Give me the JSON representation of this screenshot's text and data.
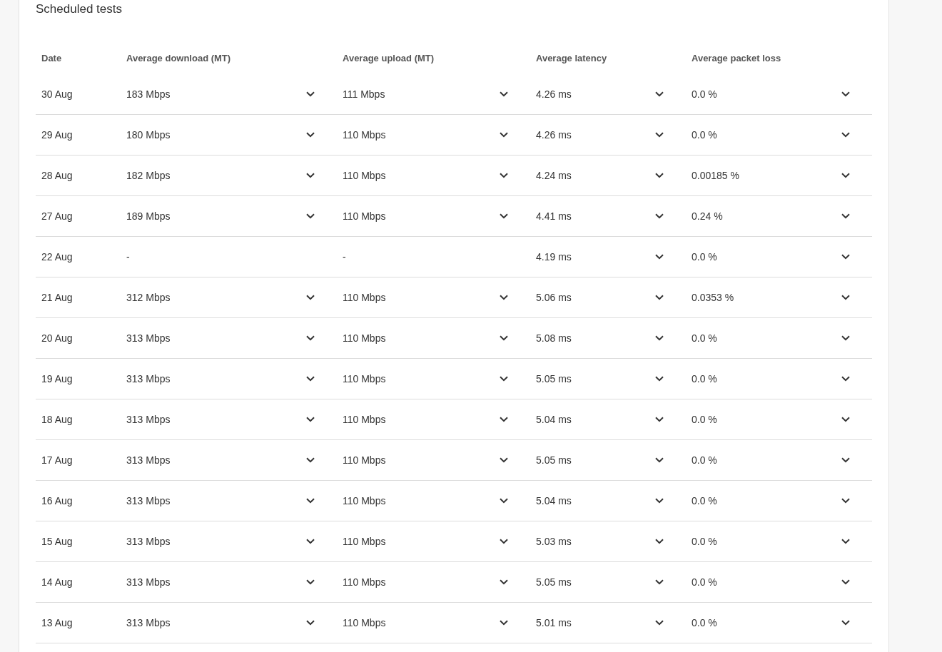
{
  "section": {
    "title": "Scheduled tests"
  },
  "table": {
    "columns": [
      "Date",
      "Average download (MT)",
      "Average upload (MT)",
      "Average latency",
      "Average packet loss"
    ],
    "rows": [
      {
        "cells": [
          {
            "value": "30 Aug"
          },
          {
            "value": "183 Mbps",
            "expandable": true
          },
          {
            "value": "111 Mbps",
            "expandable": true
          },
          {
            "value": "4.26 ms",
            "expandable": true
          },
          {
            "value": "0.0 %",
            "expandable": true
          }
        ]
      },
      {
        "cells": [
          {
            "value": "29 Aug"
          },
          {
            "value": "180 Mbps",
            "expandable": true
          },
          {
            "value": "110 Mbps",
            "expandable": true
          },
          {
            "value": "4.26 ms",
            "expandable": true
          },
          {
            "value": "0.0 %",
            "expandable": true
          }
        ]
      },
      {
        "cells": [
          {
            "value": "28 Aug"
          },
          {
            "value": "182 Mbps",
            "expandable": true
          },
          {
            "value": "110 Mbps",
            "expandable": true
          },
          {
            "value": "4.24 ms",
            "expandable": true
          },
          {
            "value": "0.00185 %",
            "expandable": true
          }
        ]
      },
      {
        "cells": [
          {
            "value": "27 Aug"
          },
          {
            "value": "189 Mbps",
            "expandable": true
          },
          {
            "value": "110 Mbps",
            "expandable": true
          },
          {
            "value": "4.41 ms",
            "expandable": true
          },
          {
            "value": "0.24 %",
            "expandable": true
          }
        ]
      },
      {
        "cells": [
          {
            "value": "22 Aug"
          },
          {
            "value": "-",
            "expandable": false
          },
          {
            "value": "-",
            "expandable": false
          },
          {
            "value": "4.19 ms",
            "expandable": true
          },
          {
            "value": "0.0 %",
            "expandable": true
          }
        ]
      },
      {
        "cells": [
          {
            "value": "21 Aug"
          },
          {
            "value": "312 Mbps",
            "expandable": true
          },
          {
            "value": "110 Mbps",
            "expandable": true
          },
          {
            "value": "5.06 ms",
            "expandable": true
          },
          {
            "value": "0.0353 %",
            "expandable": true
          }
        ]
      },
      {
        "cells": [
          {
            "value": "20 Aug"
          },
          {
            "value": "313 Mbps",
            "expandable": true
          },
          {
            "value": "110 Mbps",
            "expandable": true
          },
          {
            "value": "5.08 ms",
            "expandable": true
          },
          {
            "value": "0.0 %",
            "expandable": true
          }
        ]
      },
      {
        "cells": [
          {
            "value": "19 Aug"
          },
          {
            "value": "313 Mbps",
            "expandable": true
          },
          {
            "value": "110 Mbps",
            "expandable": true
          },
          {
            "value": "5.05 ms",
            "expandable": true
          },
          {
            "value": "0.0 %",
            "expandable": true
          }
        ]
      },
      {
        "cells": [
          {
            "value": "18 Aug"
          },
          {
            "value": "313 Mbps",
            "expandable": true
          },
          {
            "value": "110 Mbps",
            "expandable": true
          },
          {
            "value": "5.04 ms",
            "expandable": true
          },
          {
            "value": "0.0 %",
            "expandable": true
          }
        ]
      },
      {
        "cells": [
          {
            "value": "17 Aug"
          },
          {
            "value": "313 Mbps",
            "expandable": true
          },
          {
            "value": "110 Mbps",
            "expandable": true
          },
          {
            "value": "5.05 ms",
            "expandable": true
          },
          {
            "value": "0.0 %",
            "expandable": true
          }
        ]
      },
      {
        "cells": [
          {
            "value": "16 Aug"
          },
          {
            "value": "313 Mbps",
            "expandable": true
          },
          {
            "value": "110 Mbps",
            "expandable": true
          },
          {
            "value": "5.04 ms",
            "expandable": true
          },
          {
            "value": "0.0 %",
            "expandable": true
          }
        ]
      },
      {
        "cells": [
          {
            "value": "15 Aug"
          },
          {
            "value": "313 Mbps",
            "expandable": true
          },
          {
            "value": "110 Mbps",
            "expandable": true
          },
          {
            "value": "5.03 ms",
            "expandable": true
          },
          {
            "value": "0.0 %",
            "expandable": true
          }
        ]
      },
      {
        "cells": [
          {
            "value": "14 Aug"
          },
          {
            "value": "313 Mbps",
            "expandable": true
          },
          {
            "value": "110 Mbps",
            "expandable": true
          },
          {
            "value": "5.05 ms",
            "expandable": true
          },
          {
            "value": "0.0 %",
            "expandable": true
          }
        ]
      },
      {
        "cells": [
          {
            "value": "13 Aug"
          },
          {
            "value": "313 Mbps",
            "expandable": true
          },
          {
            "value": "110 Mbps",
            "expandable": true
          },
          {
            "value": "5.01 ms",
            "expandable": true
          },
          {
            "value": "0.0 %",
            "expandable": true
          }
        ]
      }
    ]
  }
}
